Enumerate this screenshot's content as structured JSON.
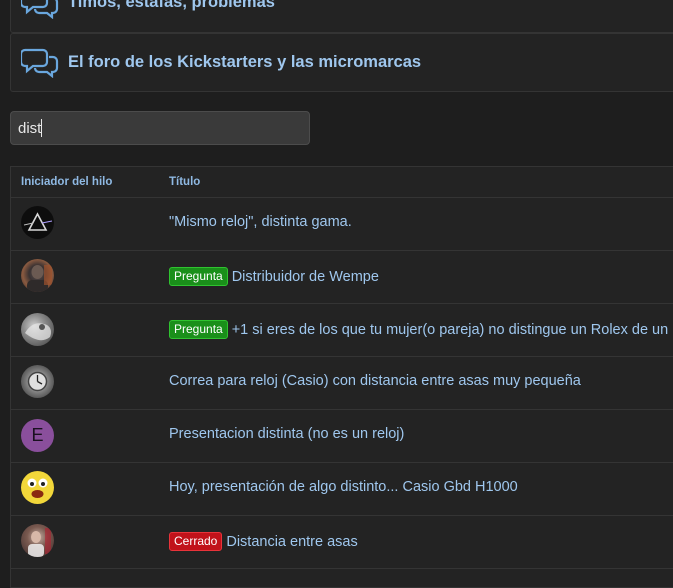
{
  "forums": [
    {
      "title": "Timos, estafas, problemas",
      "icon": "chat-bubbles-icon"
    },
    {
      "title": "El foro de los Kickstarters y las micromarcas",
      "icon": "chat-bubbles-icon"
    }
  ],
  "search": {
    "value": "dist"
  },
  "results": {
    "headers": {
      "starter": "Iniciador del hilo",
      "title": "Título"
    },
    "rows": [
      {
        "avatar": "avatar-triangle-image",
        "badge": "",
        "title": "\"Mismo reloj\", distinta gama."
      },
      {
        "avatar": "avatar-photo-image",
        "badge": "Pregunta",
        "title": "Distribuidor de Wempe"
      },
      {
        "avatar": "avatar-photo-image",
        "badge": "Pregunta",
        "title": "+1 si eres de los que tu mujer(o pareja) no distingue un Rolex de un"
      },
      {
        "avatar": "avatar-watch-image",
        "badge": "",
        "title": "Correa para reloj (Casio) con distancia entre asas muy pequeña"
      },
      {
        "avatar": "avatar-letter",
        "letter": "E",
        "badge": "",
        "title": "Presentacion distinta (no es un reloj)"
      },
      {
        "avatar": "avatar-emoji-image",
        "badge": "",
        "title": "Hoy, presentación de algo distinto... Casio Gbd H1000"
      },
      {
        "avatar": "avatar-photo-image",
        "badge": "Cerrado",
        "title": "Distancia entre asas"
      }
    ]
  },
  "colors": {
    "background": "#1e1e1e",
    "link": "#9fc7ee",
    "badge_question": "#1a8f1a",
    "badge_closed": "#c1121a",
    "avatar_letter_bg": "#8a4f9c"
  }
}
